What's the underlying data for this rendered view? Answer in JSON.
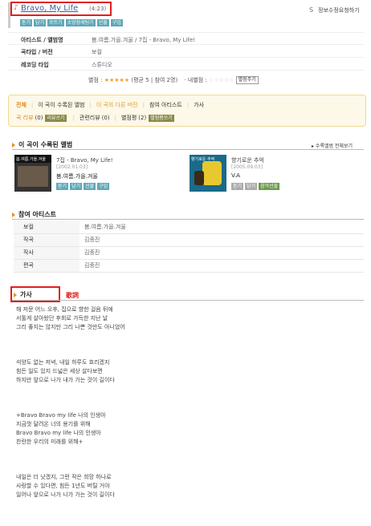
{
  "song": {
    "title": "Bravo, My Life",
    "duration": "(4:23)",
    "buttons": [
      "듣기",
      "담기",
      "쏘트기",
      "소망장세팅기",
      "선물",
      "구입"
    ],
    "report_link": "정보수정요청하기"
  },
  "info": [
    {
      "label": "아티스트 / 앨범명",
      "value": "봄.여름.가을.겨울 / 7집 - Bravo, My Life!"
    },
    {
      "label": "곡타입 / 버전",
      "value": "보컬"
    },
    {
      "label": "레코딩 타입",
      "value": "스튜디오"
    }
  ],
  "rating": {
    "label": "별점 :",
    "avg_text": "(평균 5 | 참여 2명)",
    "mine_label": "내별점 :",
    "submit_btn": "별점주기",
    "score": 5,
    "max": 5
  },
  "tabs": {
    "row1": [
      "전체",
      "이 곡이 수록된 앨범",
      "이 곡의 다른 버전",
      "참여 아티스트",
      "가사"
    ],
    "row2": [
      {
        "label": "곡 리뷰",
        "count": "(0)",
        "btn": "리뷰쓰기"
      },
      {
        "label": "관련리뷰",
        "count": "(0)",
        "btn": ""
      },
      {
        "label": "별점평",
        "count": "(2)",
        "btn": "별점평쓰기"
      }
    ]
  },
  "albums_section": {
    "title": "이 곡이 수록된 앨범",
    "view_all": "수록앨범 전체보기",
    "albums": [
      {
        "name": "7집 - Bravo, My Life!",
        "date": "[2002.01.03]",
        "artist": "봄.여름.가을.겨울",
        "buttons": [
          "듣기",
          "담기",
          "선물",
          "구입"
        ],
        "cover_badge": "봄.여름.가을.겨울"
      },
      {
        "name": "향기로운 추억",
        "date": "[2005.09.03]",
        "artist": "V.A",
        "buttons": [
          "듣기",
          "담기"
        ],
        "extra_btn": "음악선물",
        "cover_badge": "향기로운 추억"
      }
    ]
  },
  "artists_section": {
    "title": "참여 아티스트",
    "rows": [
      {
        "k": "보컬",
        "v": "봄.여름.가을.겨울"
      },
      {
        "k": "작곡",
        "v": "김종진"
      },
      {
        "k": "작사",
        "v": "김종진"
      },
      {
        "k": "편곡",
        "v": "김종진"
      }
    ]
  },
  "lyrics_section": {
    "title": "가사",
    "annotation": "歌詞",
    "stanzas": [
      [
        "해 저문 어느 오후, 집으로 향한 걸음 뒤에",
        "서툴게 살아왔던 후회로 가득한 지난 날",
        "그리 좋지는 않지만 그리 나쁜 것만도 아니었어"
      ],
      [
        "석양도 없는 저녁, 내일 하루도 흐리겠지",
        "힘든 일도 있지 드넓은 세상 살다보면",
        "하지만 앞으로 나가 내가 가는 것이 길이다"
      ],
      [
        "+Bravo Bravo my life 나의 인생아",
        "지금껏 달려온 너의 용기를 위해",
        "Bravo Bravo my life 나의 인생아",
        "찬란한 우리의 미래를 위해+"
      ],
      [
        "내일은 더 낫겠지, 그런 작은 희망 하나로",
        "사랑할 수 있다면, 힘든 1년도 버틸 거야",
        "일어나 앞으로 나가 니가 가는 것이 길이다"
      ]
    ]
  }
}
